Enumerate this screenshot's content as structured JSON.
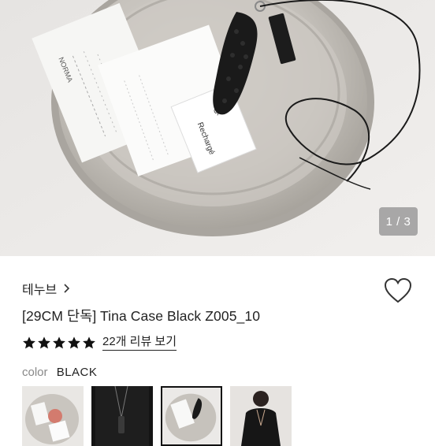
{
  "gallery": {
    "pager": "1 / 3",
    "tag_text": {
      "line1": "NORMA",
      "line2": "Rechargé",
      "line3": "%"
    }
  },
  "product": {
    "brand": "테누브",
    "title": "[29CM 단독] Tina Case Black Z005_10",
    "rating": 5,
    "reviews_label": "22개 리뷰 보기",
    "color_label": "color",
    "color_value": "BLACK"
  },
  "thumbnails": [
    {
      "name": "thumb-1",
      "selected": false
    },
    {
      "name": "thumb-2",
      "selected": false
    },
    {
      "name": "thumb-3",
      "selected": true
    },
    {
      "name": "thumb-4",
      "selected": false
    }
  ],
  "icons": {
    "heart": "heart-icon",
    "chevron": "chevron-right-icon",
    "star": "star-icon"
  },
  "colors": {
    "text": "#222222",
    "muted": "#888888",
    "star": "#111111",
    "pager_bg": "#8c8c8c"
  }
}
